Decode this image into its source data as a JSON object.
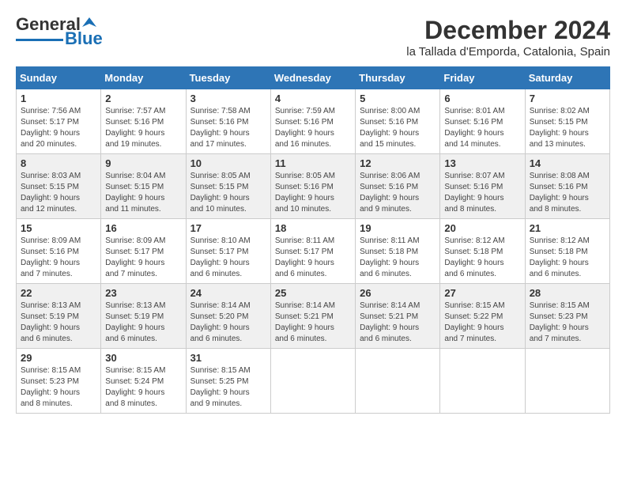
{
  "header": {
    "logo": {
      "line1": "General",
      "line2": "Blue"
    },
    "title": "December 2024",
    "subtitle": "la Tallada d'Emporda, Catalonia, Spain"
  },
  "calendar": {
    "headers": [
      "Sunday",
      "Monday",
      "Tuesday",
      "Wednesday",
      "Thursday",
      "Friday",
      "Saturday"
    ],
    "weeks": [
      [
        {
          "day": "",
          "info": ""
        },
        {
          "day": "",
          "info": ""
        },
        {
          "day": "",
          "info": ""
        },
        {
          "day": "",
          "info": ""
        },
        {
          "day": "5",
          "info": "Sunrise: 8:00 AM\nSunset: 5:16 PM\nDaylight: 9 hours and 15 minutes."
        },
        {
          "day": "6",
          "info": "Sunrise: 8:01 AM\nSunset: 5:16 PM\nDaylight: 9 hours and 14 minutes."
        },
        {
          "day": "7",
          "info": "Sunrise: 8:02 AM\nSunset: 5:15 PM\nDaylight: 9 hours and 13 minutes."
        }
      ],
      [
        {
          "day": "1",
          "info": "Sunrise: 7:56 AM\nSunset: 5:17 PM\nDaylight: 9 hours and 20 minutes."
        },
        {
          "day": "2",
          "info": "Sunrise: 7:57 AM\nSunset: 5:16 PM\nDaylight: 9 hours and 19 minutes."
        },
        {
          "day": "3",
          "info": "Sunrise: 7:58 AM\nSunset: 5:16 PM\nDaylight: 9 hours and 17 minutes."
        },
        {
          "day": "4",
          "info": "Sunrise: 7:59 AM\nSunset: 5:16 PM\nDaylight: 9 hours and 16 minutes."
        },
        {
          "day": "5",
          "info": "Sunrise: 8:00 AM\nSunset: 5:16 PM\nDaylight: 9 hours and 15 minutes."
        },
        {
          "day": "6",
          "info": "Sunrise: 8:01 AM\nSunset: 5:16 PM\nDaylight: 9 hours and 14 minutes."
        },
        {
          "day": "7",
          "info": "Sunrise: 8:02 AM\nSunset: 5:15 PM\nDaylight: 9 hours and 13 minutes."
        }
      ],
      [
        {
          "day": "8",
          "info": "Sunrise: 8:03 AM\nSunset: 5:15 PM\nDaylight: 9 hours and 12 minutes."
        },
        {
          "day": "9",
          "info": "Sunrise: 8:04 AM\nSunset: 5:15 PM\nDaylight: 9 hours and 11 minutes."
        },
        {
          "day": "10",
          "info": "Sunrise: 8:05 AM\nSunset: 5:15 PM\nDaylight: 9 hours and 10 minutes."
        },
        {
          "day": "11",
          "info": "Sunrise: 8:05 AM\nSunset: 5:16 PM\nDaylight: 9 hours and 10 minutes."
        },
        {
          "day": "12",
          "info": "Sunrise: 8:06 AM\nSunset: 5:16 PM\nDaylight: 9 hours and 9 minutes."
        },
        {
          "day": "13",
          "info": "Sunrise: 8:07 AM\nSunset: 5:16 PM\nDaylight: 9 hours and 8 minutes."
        },
        {
          "day": "14",
          "info": "Sunrise: 8:08 AM\nSunset: 5:16 PM\nDaylight: 9 hours and 8 minutes."
        }
      ],
      [
        {
          "day": "15",
          "info": "Sunrise: 8:09 AM\nSunset: 5:16 PM\nDaylight: 9 hours and 7 minutes."
        },
        {
          "day": "16",
          "info": "Sunrise: 8:09 AM\nSunset: 5:17 PM\nDaylight: 9 hours and 7 minutes."
        },
        {
          "day": "17",
          "info": "Sunrise: 8:10 AM\nSunset: 5:17 PM\nDaylight: 9 hours and 6 minutes."
        },
        {
          "day": "18",
          "info": "Sunrise: 8:11 AM\nSunset: 5:17 PM\nDaylight: 9 hours and 6 minutes."
        },
        {
          "day": "19",
          "info": "Sunrise: 8:11 AM\nSunset: 5:18 PM\nDaylight: 9 hours and 6 minutes."
        },
        {
          "day": "20",
          "info": "Sunrise: 8:12 AM\nSunset: 5:18 PM\nDaylight: 9 hours and 6 minutes."
        },
        {
          "day": "21",
          "info": "Sunrise: 8:12 AM\nSunset: 5:18 PM\nDaylight: 9 hours and 6 minutes."
        }
      ],
      [
        {
          "day": "22",
          "info": "Sunrise: 8:13 AM\nSunset: 5:19 PM\nDaylight: 9 hours and 6 minutes."
        },
        {
          "day": "23",
          "info": "Sunrise: 8:13 AM\nSunset: 5:19 PM\nDaylight: 9 hours and 6 minutes."
        },
        {
          "day": "24",
          "info": "Sunrise: 8:14 AM\nSunset: 5:20 PM\nDaylight: 9 hours and 6 minutes."
        },
        {
          "day": "25",
          "info": "Sunrise: 8:14 AM\nSunset: 5:21 PM\nDaylight: 9 hours and 6 minutes."
        },
        {
          "day": "26",
          "info": "Sunrise: 8:14 AM\nSunset: 5:21 PM\nDaylight: 9 hours and 6 minutes."
        },
        {
          "day": "27",
          "info": "Sunrise: 8:15 AM\nSunset: 5:22 PM\nDaylight: 9 hours and 7 minutes."
        },
        {
          "day": "28",
          "info": "Sunrise: 8:15 AM\nSunset: 5:23 PM\nDaylight: 9 hours and 7 minutes."
        }
      ],
      [
        {
          "day": "29",
          "info": "Sunrise: 8:15 AM\nSunset: 5:23 PM\nDaylight: 9 hours and 8 minutes."
        },
        {
          "day": "30",
          "info": "Sunrise: 8:15 AM\nSunset: 5:24 PM\nDaylight: 9 hours and 8 minutes."
        },
        {
          "day": "31",
          "info": "Sunrise: 8:15 AM\nSunset: 5:25 PM\nDaylight: 9 hours and 9 minutes."
        },
        {
          "day": "",
          "info": ""
        },
        {
          "day": "",
          "info": ""
        },
        {
          "day": "",
          "info": ""
        },
        {
          "day": "",
          "info": ""
        }
      ]
    ]
  }
}
